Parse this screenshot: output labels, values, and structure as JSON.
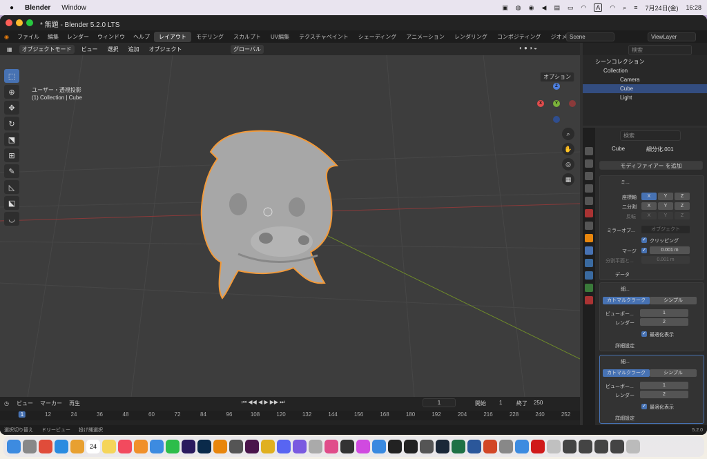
{
  "menubar": {
    "app": "Blender",
    "menu": "Window",
    "date": "7月24日(金)",
    "time": "16:28",
    "input_mode": "A"
  },
  "window": {
    "title": "* 無題 - Blender 5.2.0 LTS"
  },
  "topbar": {
    "menus": [
      "ファイル",
      "編集",
      "レンダー",
      "ウィンドウ",
      "ヘルプ"
    ],
    "tabs": [
      "レイアウト",
      "モデリング",
      "スカルプト",
      "UV編集",
      "テクスチャペイント",
      "シェーディング",
      "アニメーション",
      "レンダリング",
      "コンポジティング",
      "ジオメトリ"
    ],
    "scene": "Scene",
    "view_layer": "ViewLayer"
  },
  "viewport": {
    "mode": "オブジェクトモード",
    "menus": [
      "ビュー",
      "選択",
      "追加",
      "オブジェクト"
    ],
    "transform": "グローバル",
    "options": "オプション",
    "info1": "ユーザー・透視投影",
    "info2": "(1) Collection | Cube",
    "gizmo": {
      "x": "X",
      "y": "Y",
      "z": "Z"
    }
  },
  "timeline": {
    "menus": [
      "ビュー",
      "マーカー",
      "再生"
    ],
    "current": "1",
    "start_label": "開始",
    "start": "1",
    "end_label": "終了",
    "end": "250",
    "ticks": [
      "1",
      "12",
      "24",
      "36",
      "48",
      "60",
      "72",
      "84",
      "96",
      "108",
      "120",
      "132",
      "144",
      "156",
      "168",
      "180",
      "192",
      "204",
      "216",
      "228",
      "240",
      "252"
    ]
  },
  "status": {
    "left1": "選択切り替え",
    "left2": "ドリービュー",
    "left3": "投げ縄選択",
    "version": "5.2.0"
  },
  "outliner": {
    "search_placeholder": "検索",
    "root": "シーンコレクション",
    "collection": "Collection",
    "items": [
      "Camera",
      "Cube",
      "Light"
    ]
  },
  "properties": {
    "search_placeholder": "検索",
    "obj": "Cube",
    "mod": "細分化.001",
    "add_modifier": "モディファイアー を追加",
    "mirror": {
      "name": "ミ...",
      "axis_label": "座標軸",
      "bisect_label": "二分割",
      "flip_label": "反転",
      "x": "X",
      "y": "Y",
      "z": "Z",
      "mirror_obj_label": "ミラーオブ...",
      "mirror_obj_ph": "オブジェクト",
      "clipping": "クリッピング",
      "merge_label": "マージ",
      "merge_val": "0.001 m",
      "bisect_dist_label": "分割平面と...",
      "bisect_dist_val": "0.001 m",
      "data": "データ"
    },
    "sub1": {
      "name": "細...",
      "catmull": "カトマルクラーク",
      "simple": "シンプル",
      "viewport_label": "ビューポー...",
      "viewport_val": "1",
      "render_label": "レンダー",
      "render_val": "2",
      "optimal": "最適化表示",
      "advanced": "詳細設定"
    },
    "sub2": {
      "name": "細...",
      "catmull": "カトマルクラーク",
      "simple": "シンプル",
      "viewport_label": "ビューポー...",
      "viewport_val": "1",
      "render_label": "レンダー",
      "render_val": "2",
      "optimal": "最適化表示",
      "advanced": "詳細設定"
    }
  },
  "dock": {
    "calendar_day": "24"
  },
  "colors": {
    "accent": "#4772b3",
    "selected_outline": "#f29a3a",
    "background": "#3d3d3d"
  }
}
